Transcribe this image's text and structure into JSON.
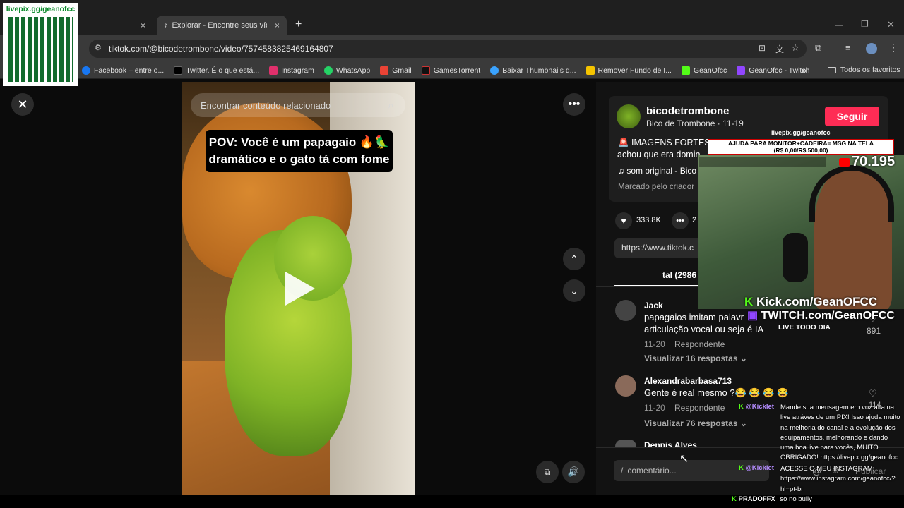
{
  "browser": {
    "tabs": [
      {
        "title": "",
        "close": "×"
      },
      {
        "title": "Explorar - Encontre seus vídeos",
        "close": "×"
      }
    ],
    "new_tab": "+",
    "url": "tiktok.com/@bicodetrombone/video/7574583825469164807",
    "bookmarks": [
      {
        "label": "Facebook – entre o...",
        "color": "#1877f2"
      },
      {
        "label": "Twitter. É o que está...",
        "color": "#000000"
      },
      {
        "label": "Instagram",
        "color": "#e1306c"
      },
      {
        "label": "WhatsApp",
        "color": "#25d366"
      },
      {
        "label": "Gmail",
        "color": "#ea4335"
      },
      {
        "label": "GamesTorrent",
        "color": "#111111"
      },
      {
        "label": "Baixar Thumbnails d...",
        "color": "#3aa3ff"
      },
      {
        "label": "Remover Fundo de I...",
        "color": "#f5c400"
      },
      {
        "label": "GeanOfcc",
        "color": "#53fc18"
      },
      {
        "label": "GeanOfcc - Twitch",
        "color": "#9146ff"
      }
    ],
    "bookmarks_more": "»",
    "all_favorites": "Todos os favoritos"
  },
  "video": {
    "search_placeholder": "Encontrar conteúdo relacionado",
    "caption_line1": "POV: Você é um papagaio 🔥🦜",
    "caption_line2": "dramático e o gato tá com fome"
  },
  "post": {
    "username": "bicodetrombone",
    "subtitle": "Bico de Trombone · 11-19",
    "follow": "Seguir",
    "desc_line1": "🚨 IMAGENS FORTES",
    "desc_line2": "achou que era domin",
    "sound": "♫  som original - Bico",
    "tagged": "Marcado pelo criador",
    "likes": "333.8K",
    "comments_count": "2",
    "link": "https://www.tiktok.c",
    "tab_label": "tal (2986"
  },
  "comments": [
    {
      "author": "Jack",
      "text1": "papagaios imitam palavr",
      "text2": "articulação vocal ou seja é IA",
      "date": "11-20",
      "reply": "Respondente",
      "likes": "891",
      "view_replies": "Visualizar 16 respostas ⌄"
    },
    {
      "author": "Alexandrabarbasa713",
      "text1": "Gente é real mesmo ?😂 😂 😂 😂",
      "date": "11-20",
      "reply": "Respondente",
      "likes": "114",
      "view_replies": "Visualizar 76 respostas ⌄"
    },
    {
      "author": "Dennis Alves"
    }
  ],
  "comment_input": {
    "prefix": "/",
    "placeholder": "comentário...",
    "post": "Publicar"
  },
  "overlay": {
    "qr_label": "livepix.gg/geanofcc",
    "livepix_small": "livepix.gg/geanofcc",
    "donation_line1": "AJUDA PARA MONITOR+CADEIRA= MSG NA TELA",
    "donation_line2": "(R$ 0,00/R$ 500,00)",
    "counter": "70.195",
    "kick": "Kick.com/GeanOFCC",
    "twitch": "TWITCH.com/GeanOFCC",
    "live_daily": "LIVE TODO DIA",
    "chat": [
      {
        "badge": "K",
        "name": "@Kicklet",
        "lines": [
          "Mande sua mensagem em voz alta na",
          "live atráves de um PIX! Isso ajuda muito",
          "na melhoria do canal e a evolução dos",
          "equipamentos, melhorando e dando",
          "uma boa live para vocês, MUITO",
          "OBRIGADO! https://livepix.gg/geanofcc"
        ]
      },
      {
        "badge": "K",
        "name": "@Kicklet",
        "lines": [
          "ACESSE O MEU INSTAGRAM:",
          "https://www.instagram.com/geanofcc/?",
          "hl=pt-br"
        ]
      },
      {
        "badge": "K",
        "name": "PRADOFFX",
        "lines": [
          "so no bully"
        ]
      }
    ]
  },
  "colors": {
    "accent": "#fe2c55",
    "kick": "#53fc18",
    "twitch": "#9146ff"
  }
}
